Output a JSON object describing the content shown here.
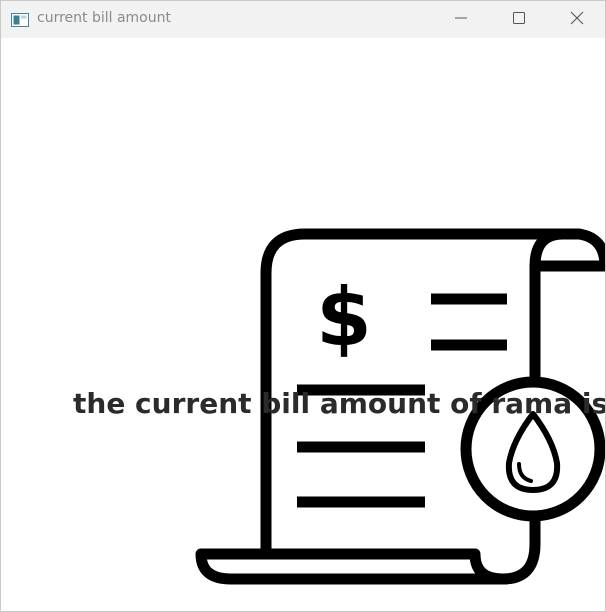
{
  "window": {
    "title": "current bill amount",
    "app_icon": "window-app-icon",
    "controls": {
      "minimize_icon": "minimize-icon",
      "maximize_icon": "maximize-icon",
      "close_icon": "close-icon"
    }
  },
  "content": {
    "illustration_icon": "water-bill-receipt-icon",
    "message": "the current bill amount of rama is"
  },
  "colors": {
    "titlebar_bg": "#f2f2f2",
    "title_text": "#8a8a8a",
    "illustration_stroke": "#000000",
    "message_text": "#2b2b2b"
  }
}
